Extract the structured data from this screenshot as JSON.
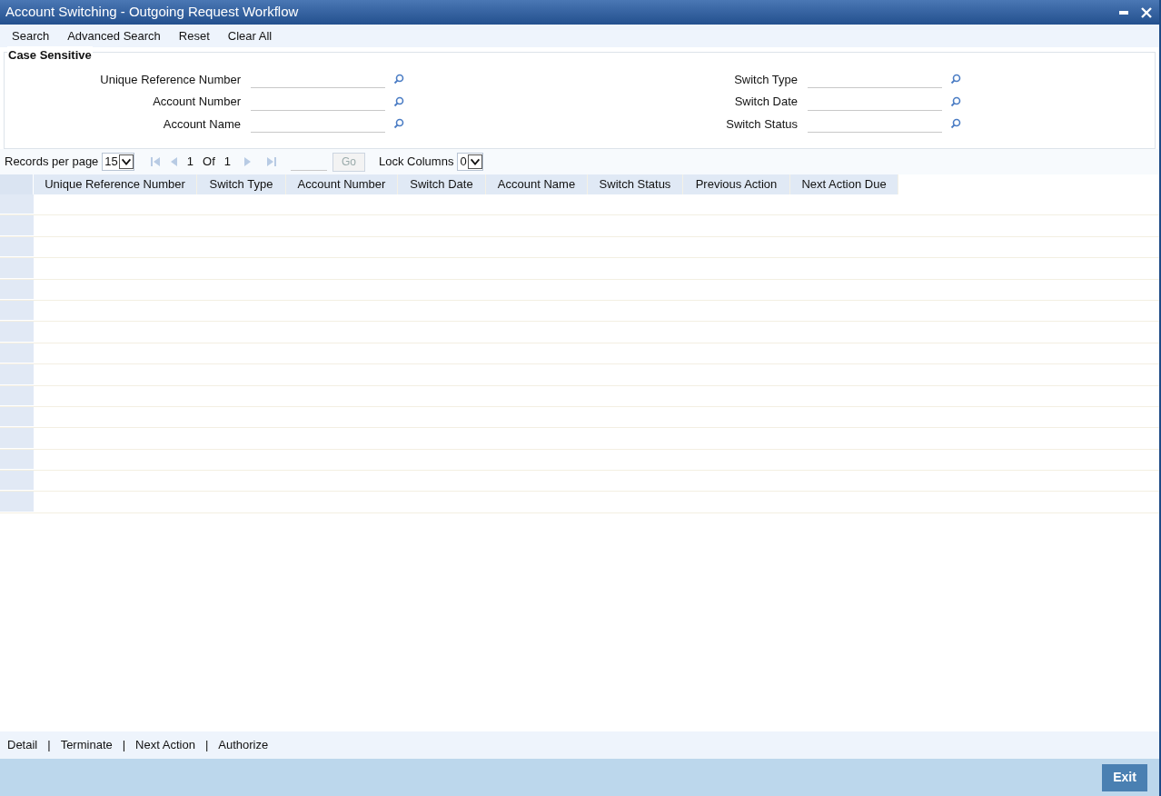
{
  "window": {
    "title": "Account Switching - Outgoing Request Workflow"
  },
  "toolbar": [
    "Search",
    "Advanced Search",
    "Reset",
    "Clear All"
  ],
  "criteria": {
    "title": "Case Sensitive",
    "left": [
      {
        "label": "Unique Reference Number"
      },
      {
        "label": "Account Number"
      },
      {
        "label": "Account Name"
      }
    ],
    "right": [
      {
        "label": "Switch Type"
      },
      {
        "label": "Switch Date"
      },
      {
        "label": "Switch Status"
      }
    ]
  },
  "pagination": {
    "records_label": "Records per page",
    "records_per_page": "15",
    "page": "1",
    "of_label": "Of",
    "total_pages": "1",
    "go": "Go",
    "lock_label": "Lock Columns",
    "lock_columns": "0"
  },
  "table": {
    "columns": [
      {
        "label": "Unique Reference Number"
      },
      {
        "label": "Switch Type"
      },
      {
        "label": "Account Number"
      },
      {
        "label": "Switch Date"
      },
      {
        "label": "Account Name"
      },
      {
        "label": "Switch Status"
      },
      {
        "label": "Previous Action"
      },
      {
        "label": "Next Action Due"
      }
    ]
  },
  "footer": {
    "actions": [
      "Detail",
      "Terminate",
      "Next Action",
      "Authorize"
    ],
    "separator": "|"
  },
  "exit": "Exit"
}
